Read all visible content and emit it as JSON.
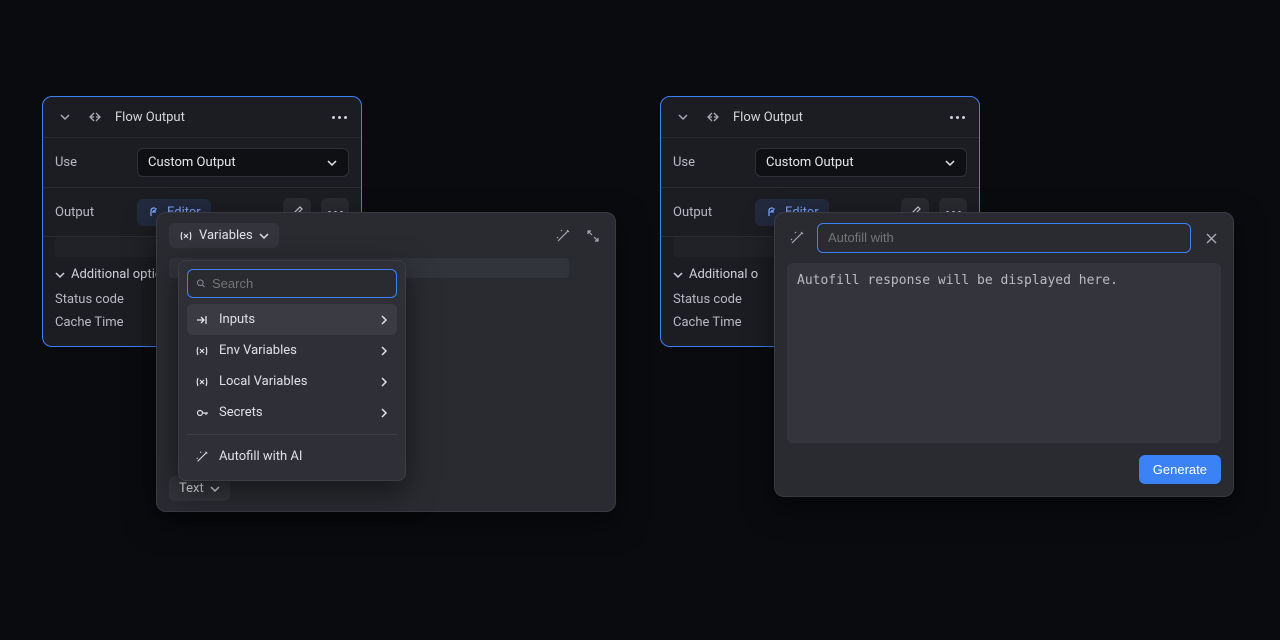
{
  "left": {
    "title": "Flow Output",
    "use_label": "Use",
    "use_value": "Custom Output",
    "output_label": "Output",
    "editor_label": "Editor",
    "additional_label": "Additional options",
    "status_label": "Status code",
    "cache_label": "Cache Time"
  },
  "vars_popover": {
    "variables_label": "Variables",
    "search_placeholder": "Search",
    "items": [
      {
        "label": "Inputs",
        "icon": "input"
      },
      {
        "label": "Env Variables",
        "icon": "vx"
      },
      {
        "label": "Local Variables",
        "icon": "vx"
      },
      {
        "label": "Secrets",
        "icon": "key"
      }
    ],
    "autofill_label": "Autofill with AI",
    "text_chip": "Text"
  },
  "right": {
    "title": "Flow Output",
    "use_label": "Use",
    "use_value": "Custom Output",
    "output_label": "Output",
    "editor_label": "Editor",
    "additional_label": "Additional o",
    "status_label": "Status code",
    "cache_label": "Cache Time"
  },
  "autofill": {
    "placeholder": "Autofill with",
    "preview_text": "Autofill response will be displayed here.",
    "generate_label": "Generate"
  }
}
